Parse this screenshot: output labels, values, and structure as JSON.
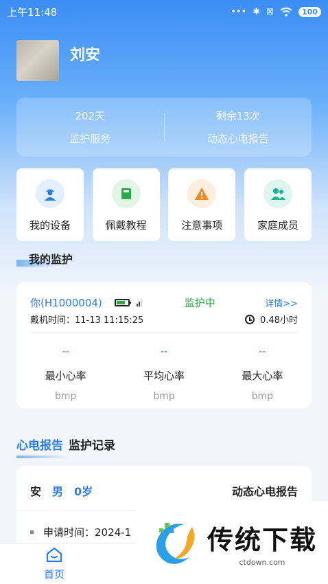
{
  "status_bar": {
    "time": "上午11:48",
    "dots": "•••",
    "bluetooth": "✱",
    "sim": "⊠",
    "wifi": "wifi",
    "battery": "100"
  },
  "profile": {
    "name": "刘安"
  },
  "stats": [
    {
      "value": "202天",
      "label": "监护服务"
    },
    {
      "value": "剩余13次",
      "label": "动态心电报告"
    }
  ],
  "quick_actions": [
    {
      "label": "我的设备",
      "icon": "person-device-icon",
      "color": "#2c7be5",
      "bg": "#e3effd"
    },
    {
      "label": "佩戴教程",
      "icon": "book-icon",
      "color": "#2aa84a",
      "bg": "#e2f5e7"
    },
    {
      "label": "注意事项",
      "icon": "warning-icon",
      "color": "#f08a24",
      "bg": "#fdeede"
    },
    {
      "label": "家庭成员",
      "icon": "family-icon",
      "color": "#1fb39a",
      "bg": "#dff5f0"
    }
  ],
  "section_title": "我的监护",
  "monitor": {
    "device": "你(H1000004)",
    "status": "监护中",
    "detail": "详情>>",
    "wear_time": "戴机时间：11-13 11:15:25",
    "duration": "0.48小时",
    "heart_rates": [
      {
        "value": "--",
        "label": "最小心率",
        "unit": "bmp",
        "color": "#e0522c"
      },
      {
        "value": "--",
        "label": "平均心率",
        "unit": "bmp",
        "color": "#2c7be5"
      },
      {
        "value": "--",
        "label": "最大心率",
        "unit": "bmp",
        "color": "#e0522c"
      }
    ]
  },
  "tabs": {
    "active": "心电报告",
    "other": "监护记录"
  },
  "report": {
    "name": "安",
    "gender": "男",
    "age": "0岁",
    "type": "动态心电报告",
    "apply_time": "申请时间：2024-1"
  },
  "bottom_nav": {
    "home": "首页"
  },
  "watermark": {
    "title": "传统下载",
    "url": "ctdown.com"
  }
}
